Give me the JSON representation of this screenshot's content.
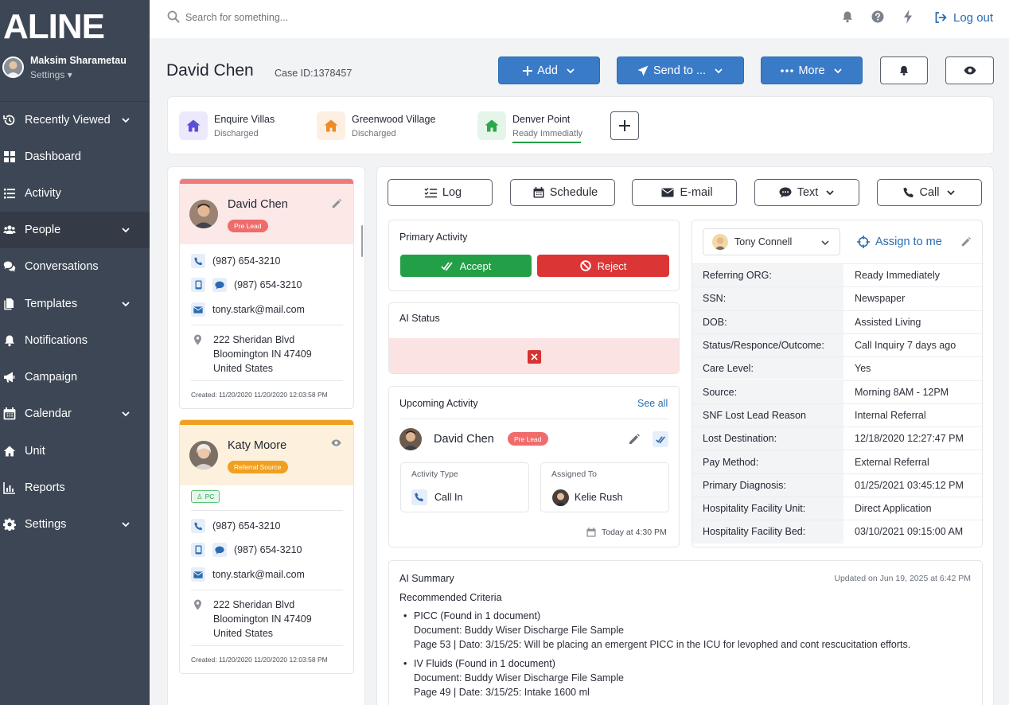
{
  "app": {
    "logo": "ALINE"
  },
  "user": {
    "name": "Maksim Sharametau",
    "settings_label": "Settings ▾"
  },
  "nav": [
    {
      "label": "Recently Viewed",
      "icon": "history-icon",
      "chevron": true
    },
    {
      "label": "Dashboard",
      "icon": "dashboard-icon",
      "chevron": false
    },
    {
      "label": "Activity",
      "icon": "list-icon",
      "chevron": false
    },
    {
      "label": "People",
      "icon": "people-icon",
      "chevron": true,
      "active": true
    },
    {
      "label": "Conversations",
      "icon": "chat-icon",
      "chevron": false
    },
    {
      "label": "Templates",
      "icon": "document-icon",
      "chevron": true
    },
    {
      "label": "Notifications",
      "icon": "bell-icon",
      "chevron": false
    },
    {
      "label": "Campaign",
      "icon": "megaphone-icon",
      "chevron": false
    },
    {
      "label": "Calendar",
      "icon": "calendar-icon",
      "chevron": true
    },
    {
      "label": "Unit",
      "icon": "home-icon",
      "chevron": false
    },
    {
      "label": "Reports",
      "icon": "bar-chart-icon",
      "chevron": false
    },
    {
      "label": "Settings",
      "icon": "gear-icon",
      "chevron": true
    }
  ],
  "topbar": {
    "search_placeholder": "Search for something...",
    "logout_label": "Log out"
  },
  "header": {
    "title": "David Chen",
    "case_id": "Case ID:1378457",
    "add_label": "Add",
    "send_label": "Send to ...",
    "more_label": "More"
  },
  "facilities": [
    {
      "name": "Enquire Villas",
      "status": "Discharged",
      "color": "#5b4fd6",
      "bg": "#ebe9fb"
    },
    {
      "name": "Greenwood Village",
      "status": "Discharged",
      "color": "#f08a24",
      "bg": "#fdf0e2"
    },
    {
      "name": "Denver Point",
      "status": "Ready Immediatly",
      "color": "#2aa84a",
      "bg": "#e6f5ea"
    }
  ],
  "contacts": [
    {
      "name": "David Chen",
      "badge": "Pre Lead",
      "badge_color": "#f06c6c",
      "head_color": "#fde8e8",
      "top_color": "#f07a7a",
      "phone": "(987) 654-3210",
      "mobile": "(987) 654-3210",
      "email": "tony.stark@mail.com",
      "address_1": "222 Sheridan Blvd",
      "address_2": "Bloomington IN 47409",
      "address_3": "United States",
      "created": "Created: 11/20/2020 11/20/2020 12:03:58 PM"
    },
    {
      "name": "Katy Moore",
      "badge": "Referral Source",
      "badge_color": "#f0a020",
      "head_color": "#fdf1de",
      "top_color": "#f0a020",
      "tag": "PC",
      "phone": "(987) 654-3210",
      "mobile": "(987) 654-3210",
      "email": "tony.stark@mail.com",
      "address_1": "222 Sheridan Blvd",
      "address_2": "Bloomington IN 47409",
      "address_3": "United States",
      "created": "Created: 11/20/2020 11/20/2020 12:03:58 PM"
    }
  ],
  "actions": {
    "log": "Log",
    "schedule": "Schedule",
    "email": "E-mail",
    "text": "Text",
    "call": "Call"
  },
  "primary_activity": {
    "title": "Primary Activity",
    "accept": "Accept",
    "reject": "Reject"
  },
  "ai_status": {
    "title": "AI Status"
  },
  "upcoming": {
    "title": "Upcoming Activity",
    "see_all": "See all",
    "person": "David Chen",
    "badge": "Pre Lead",
    "activity_type_label": "Activity Type",
    "activity_type": "Call In",
    "assigned_label": "Assigned To",
    "assigned": "Kelie Rush",
    "when": "Today at 4:30 PM"
  },
  "details": {
    "assignee": "Tony Connell",
    "assign_me": "Assign to me",
    "rows": [
      {
        "label": "Referring ORG:",
        "value": "Ready Immediately"
      },
      {
        "label": "SSN:",
        "value": "Newspaper"
      },
      {
        "label": "DOB:",
        "value": "Assisted Living"
      },
      {
        "label": "Status/Responce/Outcome:",
        "value": "Call Inquiry 7 days ago"
      },
      {
        "label": "Care Level:",
        "value": "Yes"
      },
      {
        "label": "Source:",
        "value": "Morning 8AM - 12PM"
      },
      {
        "label": "SNF Lost Lead Reason",
        "value": "Internal Referral"
      },
      {
        "label": "Lost Destination:",
        "value": "12/18/2020  12:27:47 PM"
      },
      {
        "label": "Pay Method:",
        "value": "External Referral"
      },
      {
        "label": "Primary Diagnosis:",
        "value": "01/25/2021  03:45:12 PM"
      },
      {
        "label": "Hospitality Facility Unit:",
        "value": "Direct Application"
      },
      {
        "label": "Hospitality Facility Bed:",
        "value": "03/10/2021  09:15:00 AM"
      }
    ]
  },
  "ai_summary": {
    "title": "AI Summary",
    "updated": "Updated on Jun 19, 2025 at 6:42 PM",
    "subtitle": "Recommended Criteria",
    "items": [
      {
        "heading": "PICC (Found in 1 document)",
        "document": "Document: Buddy Wiser Discharge File Sample",
        "detail": "Page 53 | Dato: 3/15/25: Will be placing an emergent PICC in the ICU for levophed and cont rescucitation efforts."
      },
      {
        "heading": "IV Fluids (Found in 1 document)",
        "document": "Document: Buddy Wiser Discharge File Sample",
        "detail": "Page 49 | Date: 3/15/25: Intake 1600 ml"
      }
    ]
  },
  "colors": {
    "sidebar": "#3d4654",
    "primary": "#3a7bc8",
    "accept": "#23a047",
    "reject": "#dc3535",
    "ai_status_bg": "#fbe3e3"
  }
}
